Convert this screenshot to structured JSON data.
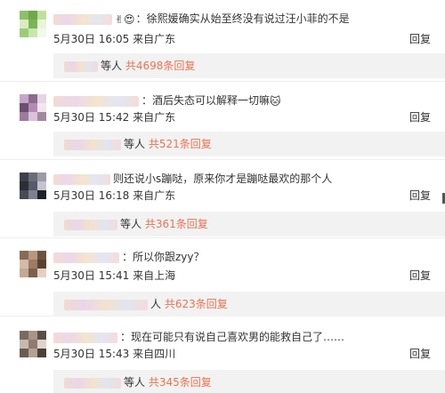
{
  "comments": [
    {
      "text": "：徐熙媛确实从始至终没有说过汪小菲的不是",
      "emoji": "✌😍",
      "date": "5月30日",
      "time": "16:05",
      "location": "来自广东",
      "reply_label": "回复",
      "sub": {
        "suffix": "等人",
        "count": "共4698条回复"
      },
      "avatar_colors": [
        "#8fbf6a",
        "#6fa84a",
        "#bfe09a",
        "#d8edc0",
        "#7bb556",
        "#e8f4dc",
        "#9ccc78",
        "#c9e6ad",
        "#f3f8ec"
      ]
    },
    {
      "text": "：酒后失态可以解释一切嘛",
      "emoji": "🐱",
      "date": "5月30日",
      "time": "15:42",
      "location": "来自广东",
      "reply_label": "回复",
      "sub": {
        "suffix": "等人",
        "count": "共521条回复"
      },
      "avatar_colors": [
        "#c7a5c9",
        "#8a6c8f",
        "#e6d4e4",
        "#6b4f6e",
        "#b48ab5",
        "#f0e6ef",
        "#9d7ba0",
        "#d9c2da",
        "#a3879f"
      ]
    },
    {
      "text": "则还说小s蹦哒，原来你才是蹦哒最欢的那个人",
      "emoji": "",
      "date": "5月30日",
      "time": "16:18",
      "location": "来自广东",
      "reply_label": "回复",
      "sub": {
        "suffix": "等人",
        "count": "共361条回复"
      },
      "avatar_colors": [
        "#3d3f4a",
        "#6a6c78",
        "#9a9ba5",
        "#2c2e36",
        "#58596a",
        "#c3c4cc",
        "#474957",
        "#7e8090",
        "#1f2028"
      ]
    },
    {
      "text": "：所以你跟zyy？",
      "emoji": "",
      "date": "5月30日",
      "time": "15:41",
      "location": "来自上海",
      "reply_label": "回复",
      "sub": {
        "suffix": "人",
        "count": "共623条回复"
      },
      "avatar_colors": [
        "#8a6a55",
        "#b89780",
        "#6e5240",
        "#d4bba8",
        "#9c7c66",
        "#5a4232",
        "#c6a892",
        "#7d604c",
        "#e2d0c2"
      ]
    },
    {
      "text": "：现在可能只有说自己喜欢男的能救自己了……",
      "emoji": "",
      "date": "5月30日",
      "time": "15:43",
      "location": "来自四川",
      "reply_label": "回复",
      "sub": {
        "suffix": "等人",
        "count": "共345条回复"
      },
      "avatar_colors": [
        "#7a6a60",
        "#a89488",
        "#5c4e46",
        "#c9b8ad",
        "#8e7c71",
        "#e0d3ca",
        "#6b5c53",
        "#b4a296",
        "#4d4039"
      ]
    }
  ]
}
